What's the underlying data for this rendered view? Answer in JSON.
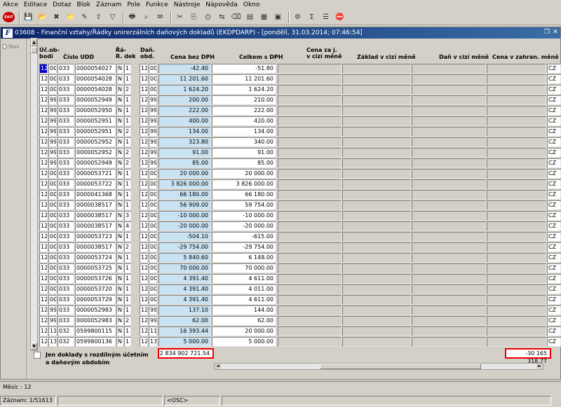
{
  "menu": [
    "Akce",
    "Editace",
    "Dotaz",
    "Blok",
    "Záznam",
    "Pole",
    "Funkce",
    "Nástroje",
    "Nápověda",
    "Okno"
  ],
  "toolbar": {
    "exit_label": "EXIT",
    "icons": [
      "save-icon",
      "open-folder-icon",
      "delete-icon",
      "add-folder-icon",
      "edit-icon",
      "export-icon",
      "filter-icon",
      "print-icon",
      "search-icon",
      "mail-icon",
      "cut-icon",
      "copy-icon",
      "paste-icon",
      "compare-icon",
      "delete-record-icon",
      "document-icon",
      "calendar-icon",
      "calculator-icon",
      "settings-icon",
      "sum-icon",
      "list-icon",
      "stop-icon"
    ]
  },
  "window": {
    "logo": "F",
    "title": "03608 - Finanční vztahy/Řádky unirerzálních daňových dokladů (EKDPDARP) - [pondělí, 31.03.2014; 07:46:54]",
    "nav_label": "Nav"
  },
  "headers": {
    "uc_obdobi": "Úč.ob-\nbodí",
    "cislo_udd": "Číslo UDD",
    "ra_dek": "Řá-\nR. dek",
    "dan_obd": "Daň.\nobd.",
    "cena_bez_dph": "Cena bez DPH",
    "celkem_s_dph": "Celkem s DPH",
    "cena_za_j": "Cena za j.\nv cizí měně",
    "zaklad_cizi": "Základ v cizí měně",
    "dan_cizi": "Daň v cizí měně",
    "cena_zahran": "Cena v zahran. měně"
  },
  "rows": [
    [
      "12",
      "00",
      "033",
      "0000054027",
      "N",
      "1",
      "12",
      "00",
      "-42.40",
      "-51.80"
    ],
    [
      "12",
      "00",
      "033",
      "0000054028",
      "N",
      "1",
      "12",
      "00",
      "11 201.60",
      "11 201.60"
    ],
    [
      "12",
      "00",
      "033",
      "0000054028",
      "N",
      "2",
      "12",
      "00",
      "1 624.20",
      "1 624.20"
    ],
    [
      "12",
      "99",
      "033",
      "0000052949",
      "N",
      "1",
      "12",
      "99",
      "200.00",
      "210.00"
    ],
    [
      "12",
      "99",
      "033",
      "0000052950",
      "N",
      "1",
      "12",
      "99",
      "222.00",
      "222.00"
    ],
    [
      "12",
      "99",
      "033",
      "0000052951",
      "N",
      "1",
      "12",
      "99",
      "400.00",
      "420.00"
    ],
    [
      "12",
      "99",
      "033",
      "0000052951",
      "N",
      "2",
      "12",
      "99",
      "134.00",
      "134.00"
    ],
    [
      "12",
      "99",
      "033",
      "0000052952",
      "N",
      "1",
      "12",
      "99",
      "323.80",
      "340.00"
    ],
    [
      "12",
      "99",
      "033",
      "0000052952",
      "N",
      "2",
      "12",
      "99",
      "91.00",
      "91.00"
    ],
    [
      "12",
      "99",
      "033",
      "0000052949",
      "N",
      "2",
      "12",
      "99",
      "85.00",
      "85.00"
    ],
    [
      "12",
      "00",
      "033",
      "0000053721",
      "N",
      "1",
      "12",
      "00",
      "20 000.00",
      "20 000.00"
    ],
    [
      "12",
      "00",
      "033",
      "0000053722",
      "N",
      "1",
      "12",
      "00",
      "3 826 000.00",
      "3 826 000.00"
    ],
    [
      "12",
      "00",
      "033",
      "0000041368",
      "N",
      "1",
      "12",
      "00",
      "66 180.00",
      "66 180.00"
    ],
    [
      "12",
      "00",
      "033",
      "0000038517",
      "N",
      "1",
      "12",
      "00",
      "56 909.00",
      "59 754.00"
    ],
    [
      "12",
      "00",
      "033",
      "0000038517",
      "N",
      "3",
      "12",
      "00",
      "-10 000.00",
      "-10 000.00"
    ],
    [
      "12",
      "00",
      "033",
      "0000038517",
      "N",
      "4",
      "12",
      "00",
      "-20 000.00",
      "-20 000.00"
    ],
    [
      "12",
      "00",
      "033",
      "0000053723",
      "N",
      "1",
      "12",
      "00",
      "-504.10",
      "-615.00"
    ],
    [
      "12",
      "00",
      "033",
      "0000038517",
      "N",
      "2",
      "12",
      "00",
      "-29 754.00",
      "-29 754.00"
    ],
    [
      "12",
      "00",
      "033",
      "0000053724",
      "N",
      "1",
      "12",
      "00",
      "5 840.60",
      "6 148.00"
    ],
    [
      "12",
      "00",
      "033",
      "0000053725",
      "N",
      "1",
      "12",
      "00",
      "70 000.00",
      "70 000.00"
    ],
    [
      "12",
      "00",
      "033",
      "0000053726",
      "N",
      "1",
      "12",
      "00",
      "4 391.40",
      "4 611.00"
    ],
    [
      "12",
      "00",
      "033",
      "0000053720",
      "N",
      "1",
      "12",
      "00",
      "4 391.40",
      "4 011.00"
    ],
    [
      "12",
      "00",
      "033",
      "0000053729",
      "N",
      "1",
      "12",
      "00",
      "4 391.40",
      "4 611.00"
    ],
    [
      "12",
      "99",
      "033",
      "0000052983",
      "N",
      "1",
      "12",
      "99",
      "137.10",
      "144.00"
    ],
    [
      "12",
      "99",
      "033",
      "0000052983",
      "N",
      "2",
      "12",
      "99",
      "62.00",
      "62.00"
    ],
    [
      "12",
      "11",
      "032",
      "0599800115",
      "N",
      "1",
      "12",
      "11",
      "16 393.44",
      "20 000.00"
    ],
    [
      "12",
      "13",
      "032",
      "0599800136",
      "N",
      "1",
      "12",
      "13",
      "5 000.00",
      "5 000.00"
    ]
  ],
  "last_col_values": [
    "CZ",
    "CZ",
    "CZ",
    "CZ",
    "CZ",
    "CZ",
    "CZ",
    "CZ",
    "CZ",
    "CZ",
    "CZ",
    "CZ",
    "CZ",
    "CZ",
    "CZ",
    "CZ",
    "CZ",
    "CZ",
    "CZ",
    "CZ",
    "CZ",
    "CZ",
    "CZ",
    "CZ",
    "CZ",
    "CZ",
    "CZ"
  ],
  "checkbox_label": "Jen doklady s rozdílným účetním a daňovým obdobím",
  "totals": {
    "cena_bez_dph": "2 834 902 721.54",
    "cena_zahran": "-30 165 318.77"
  },
  "message": "Měsíc : 12",
  "status": {
    "record": "Záznam: 1/51613",
    "mode": "<OSC>"
  }
}
